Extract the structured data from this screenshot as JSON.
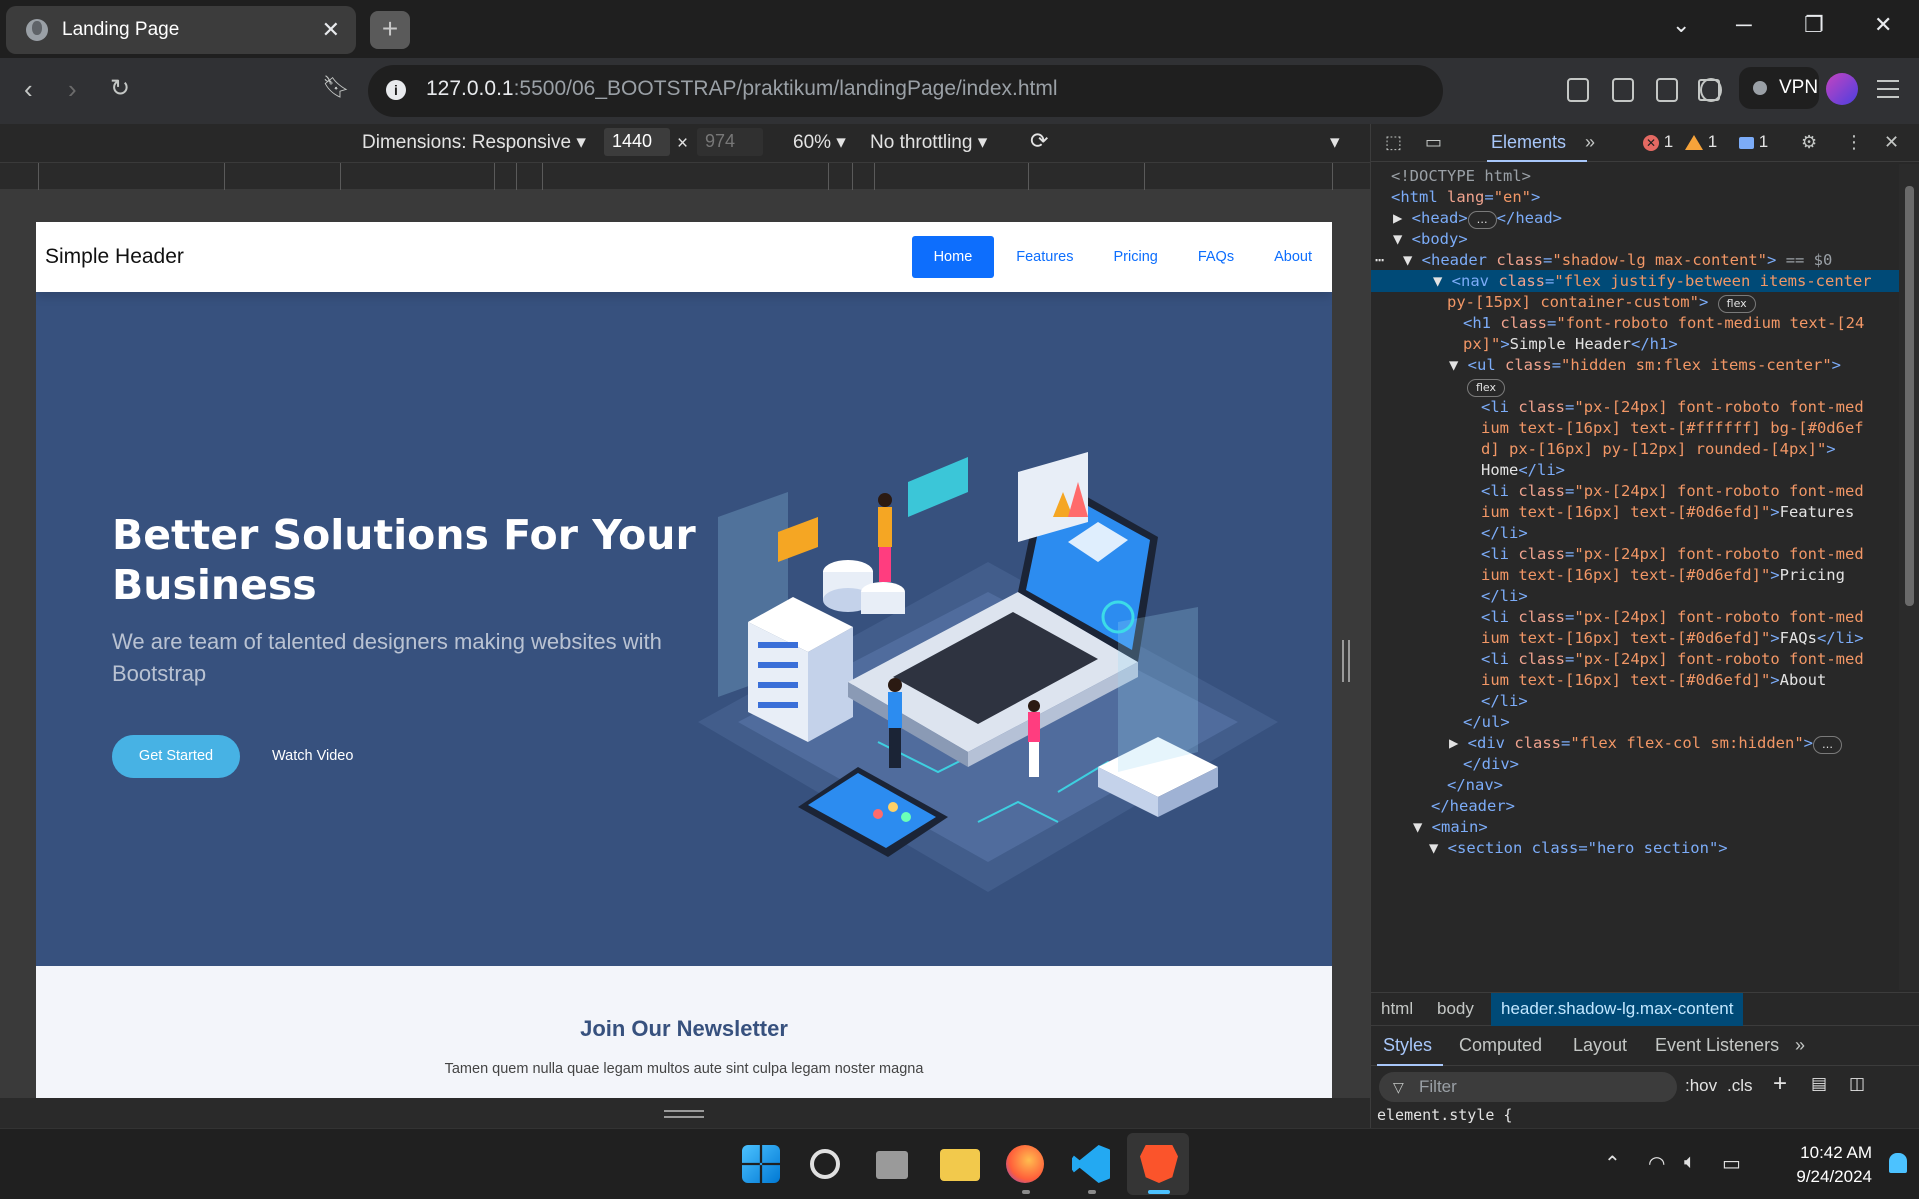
{
  "browser": {
    "tab_title": "Landing Page",
    "tab_close": "✕",
    "new_tab": "+",
    "url_host": "127.0.0.1",
    "url_rest": ":5500/06_BOOTSTRAP/praktikum/landingPage/index.html",
    "vpn_label": "VPN"
  },
  "device_toolbar": {
    "dimensions_label": "Dimensions: Responsive",
    "width": "1440",
    "height_placeholder": "974",
    "zoom": "60%",
    "throttling": "No throttling"
  },
  "site": {
    "brand": "Simple Header",
    "nav": [
      "Home",
      "Features",
      "Pricing",
      "FAQs",
      "About"
    ],
    "hero_title": "Better Solutions For Your Business",
    "hero_subtitle": "We are team of talented designers making websites with Bootstrap",
    "get_started": "Get Started",
    "watch_video": "Watch Video",
    "newsletter_title": "Join Our Newsletter",
    "newsletter_text": "Tamen quem nulla quae legam multos aute sint culpa legam noster magna",
    "colors": {
      "primary": "#0d6efd",
      "hero_bg": "#37517e",
      "accent": "#47b2e4"
    }
  },
  "devtools": {
    "tabs": {
      "elements": "Elements",
      "more": "»"
    },
    "counts": {
      "errors": "1",
      "warnings": "1",
      "messages": "1"
    },
    "dom": {
      "doctype": "<!DOCTYPE html>",
      "html_open": "<html",
      "lang_attr": "lang",
      "lang_val": "\"en\"",
      "gt": ">",
      "head": "<head>",
      "head_close": "</head>",
      "ellipsis": "…",
      "body": "<body>",
      "header_open": "<header",
      "header_class": "\"shadow-lg max-content\"",
      "selected_marker": "== $0",
      "nav_open": "<nav",
      "nav_class_1": "\"flex justify-between items-center",
      "nav_class_2": "py-[15px] container-custom\"",
      "flex_pill": "flex",
      "h1_open": "<h1",
      "h1_class_1": "\"font-roboto font-medium text-[24",
      "h1_class_2": "px]\"",
      "h1_text": "Simple Header",
      "h1_close": "</h1>",
      "ul_open": "<ul",
      "ul_class": "\"hidden sm:flex items-center\"",
      "li_open": "<li",
      "li_home_1": "\"px-[24px] font-roboto font-med",
      "li_home_2": "ium text-[16px] text-[#ffffff] bg-[#0d6ef",
      "li_home_3": "d] px-[16px] py-[12px] rounded-[4px]\"",
      "li_text_home": "Home",
      "li_close": "</li>",
      "li_other_1": "\"px-[24px] font-roboto font-med",
      "li_other_2": "ium text-[16px] text-[#0d6efd]\"",
      "li_text_features": "Features",
      "li_text_pricing": "Pricing",
      "li_text_faqs": "FAQs",
      "li_text_about": "About",
      "ul_close": "</ul>",
      "div_open": "<div",
      "div_class": "\"flex flex-col sm:hidden\"",
      "div_close": "</div>",
      "nav_close": "</nav>",
      "header_close": "</header>",
      "main_open": "<main>",
      "section_partial": "<section class=\"hero section\">",
      "class_attr": "class",
      "eq": "="
    },
    "breadcrumbs": [
      "html",
      "body",
      "header.shadow-lg.max-content"
    ],
    "style_tabs": [
      "Styles",
      "Computed",
      "Layout",
      "Event Listeners",
      "»"
    ],
    "filter_placeholder": "Filter",
    "hov": ":hov",
    "cls": ".cls",
    "element_style": "element.style {"
  },
  "taskbar": {
    "time": "10:42 AM",
    "date": "9/24/2024"
  }
}
